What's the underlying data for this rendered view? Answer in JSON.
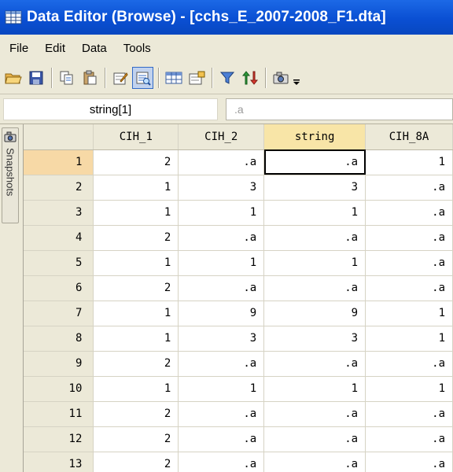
{
  "window": {
    "title": "Data Editor (Browse) - [cchs_E_2007-2008_F1.dta]",
    "icon": "grid-app-icon"
  },
  "menu": [
    "File",
    "Edit",
    "Data",
    "Tools"
  ],
  "toolbar": {
    "icons": [
      "open-folder-icon",
      "save-icon",
      "copy-icon",
      "paste-icon",
      "edit-mode-icon",
      "browse-mode-icon",
      "variables-icon",
      "properties-icon",
      "filter-icon",
      "sort-icon",
      "snapshot-icon"
    ],
    "active": "browse-mode-icon"
  },
  "entry": {
    "varname": "string[1]",
    "value": ".a"
  },
  "sidebar": {
    "snapshots_label": "Snapshots"
  },
  "grid": {
    "columns": [
      "CIH_1",
      "CIH_2",
      "string",
      "CIH_8A"
    ],
    "selected_column": "string",
    "selected_row": "1",
    "rows": [
      [
        "1",
        "2",
        ".a",
        ".a",
        "1"
      ],
      [
        "2",
        "1",
        "3",
        "3",
        ".a"
      ],
      [
        "3",
        "1",
        "1",
        "1",
        ".a"
      ],
      [
        "4",
        "2",
        ".a",
        ".a",
        ".a"
      ],
      [
        "5",
        "1",
        "1",
        "1",
        ".a"
      ],
      [
        "6",
        "2",
        ".a",
        ".a",
        ".a"
      ],
      [
        "7",
        "1",
        "9",
        "9",
        "1"
      ],
      [
        "8",
        "1",
        "3",
        "3",
        "1"
      ],
      [
        "9",
        "2",
        ".a",
        ".a",
        ".a"
      ],
      [
        "10",
        "1",
        "1",
        "1",
        "1"
      ],
      [
        "11",
        "2",
        ".a",
        ".a",
        ".a"
      ],
      [
        "12",
        "2",
        ".a",
        ".a",
        ".a"
      ],
      [
        "13",
        "2",
        ".a",
        ".a",
        ".a"
      ]
    ]
  },
  "colors": {
    "titlebar": "#0a4fd3",
    "chrome": "#ece9d8",
    "selected_header": "#f8e5a7",
    "selected_row_header": "#f7d9a6"
  }
}
